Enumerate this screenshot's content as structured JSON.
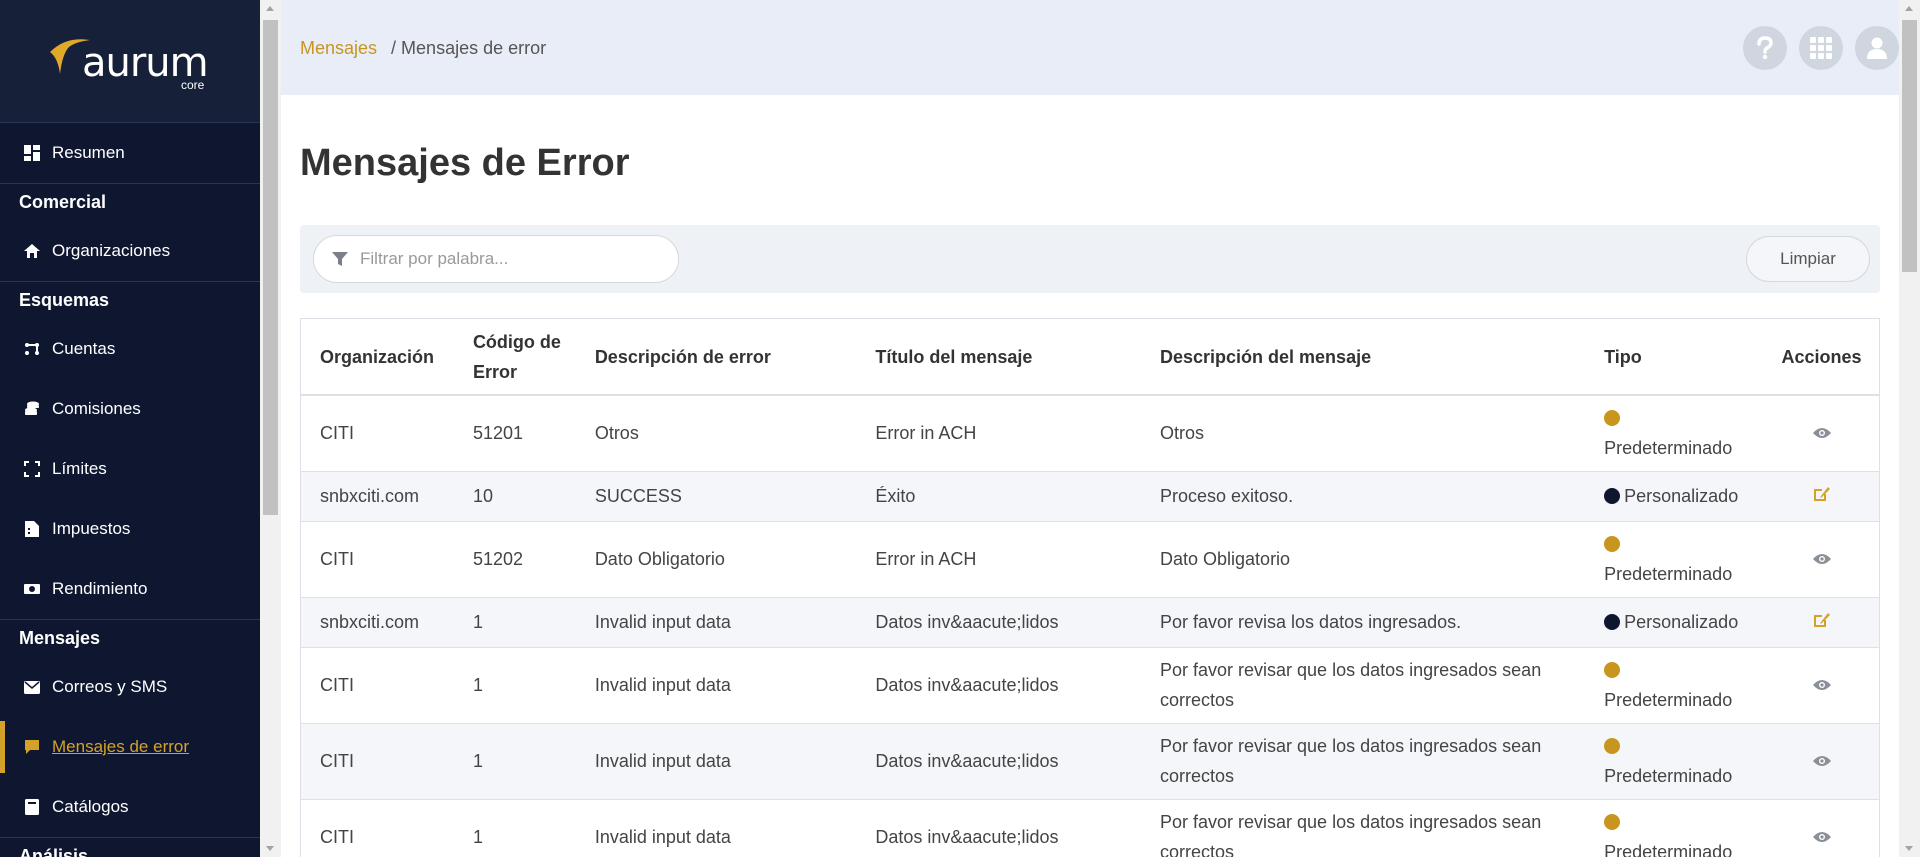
{
  "app": {
    "logo_text": "aurum",
    "logo_sub": "core"
  },
  "sidebar": {
    "items": [
      {
        "type": "item",
        "label": "Resumen",
        "icon": "dashboard-icon"
      },
      {
        "type": "section",
        "label": "Comercial"
      },
      {
        "type": "item",
        "label": "Organizaciones",
        "icon": "home-icon"
      },
      {
        "type": "section",
        "label": "Esquemas"
      },
      {
        "type": "item",
        "label": "Cuentas",
        "icon": "accounts-icon"
      },
      {
        "type": "item",
        "label": "Comisiones",
        "icon": "coins-icon"
      },
      {
        "type": "item",
        "label": "Límites",
        "icon": "expand-icon"
      },
      {
        "type": "item",
        "label": "Impuestos",
        "icon": "receipt-icon"
      },
      {
        "type": "item",
        "label": "Rendimiento",
        "icon": "money-icon"
      },
      {
        "type": "section",
        "label": "Mensajes"
      },
      {
        "type": "item",
        "label": "Correos y SMS",
        "icon": "envelope-icon"
      },
      {
        "type": "item",
        "label": "Mensajes de error",
        "icon": "comment-icon",
        "active": true
      },
      {
        "type": "item",
        "label": "Catálogos",
        "icon": "book-icon"
      },
      {
        "type": "section",
        "label": "Análisis"
      }
    ]
  },
  "breadcrumb": {
    "parent": "Mensajes",
    "current": "/ Mensajes de error"
  },
  "page": {
    "title": "Mensajes de Error"
  },
  "filter": {
    "placeholder": "Filtrar por palabra...",
    "value": "",
    "clear_label": "Limpiar"
  },
  "table": {
    "headers": [
      "Organización",
      "Código de Error",
      "Descripción de error",
      "Título del mensaje",
      "Descripción del mensaje",
      "Tipo",
      "Acciones"
    ],
    "rows": [
      {
        "org": "CITI",
        "code": "51201",
        "error_desc": "Otros",
        "msg_title": "Error in ACH",
        "msg_desc": "Otros",
        "type": "Predeterminado",
        "action": "view"
      },
      {
        "org": "snbxciti.com",
        "code": "10",
        "error_desc": "SUCCESS",
        "msg_title": "Éxito",
        "msg_desc": "Proceso exitoso.",
        "type": "Personalizado",
        "action": "edit"
      },
      {
        "org": "CITI",
        "code": "51202",
        "error_desc": "Dato Obligatorio",
        "msg_title": "Error in ACH",
        "msg_desc": "Dato Obligatorio",
        "type": "Predeterminado",
        "action": "view"
      },
      {
        "org": "snbxciti.com",
        "code": "1",
        "error_desc": "Invalid input data",
        "msg_title": "Datos inv&aacute;lidos",
        "msg_desc": "Por favor revisa los datos ingresados.",
        "type": "Personalizado",
        "action": "edit"
      },
      {
        "org": "CITI",
        "code": "1",
        "error_desc": "Invalid input data",
        "msg_title": "Datos inv&aacute;lidos",
        "msg_desc": "Por favor revisar que los datos ingresados sean correctos",
        "type": "Predeterminado",
        "action": "view"
      },
      {
        "org": "CITI",
        "code": "1",
        "error_desc": "Invalid input data",
        "msg_title": "Datos inv&aacute;lidos",
        "msg_desc": "Por favor revisar que los datos ingresados sean correctos",
        "type": "Predeterminado",
        "action": "view"
      },
      {
        "org": "CITI",
        "code": "1",
        "error_desc": "Invalid input data",
        "msg_title": "Datos inv&aacute;lidos",
        "msg_desc": "Por favor revisar que los datos ingresados sean correctos",
        "type": "Predeterminado",
        "action": "view"
      }
    ]
  },
  "colors": {
    "accent": "#d4a12a",
    "sidebar_bg": "#0f1730",
    "predeterminado": "#c8961e",
    "personalizado": "#0f1730"
  }
}
